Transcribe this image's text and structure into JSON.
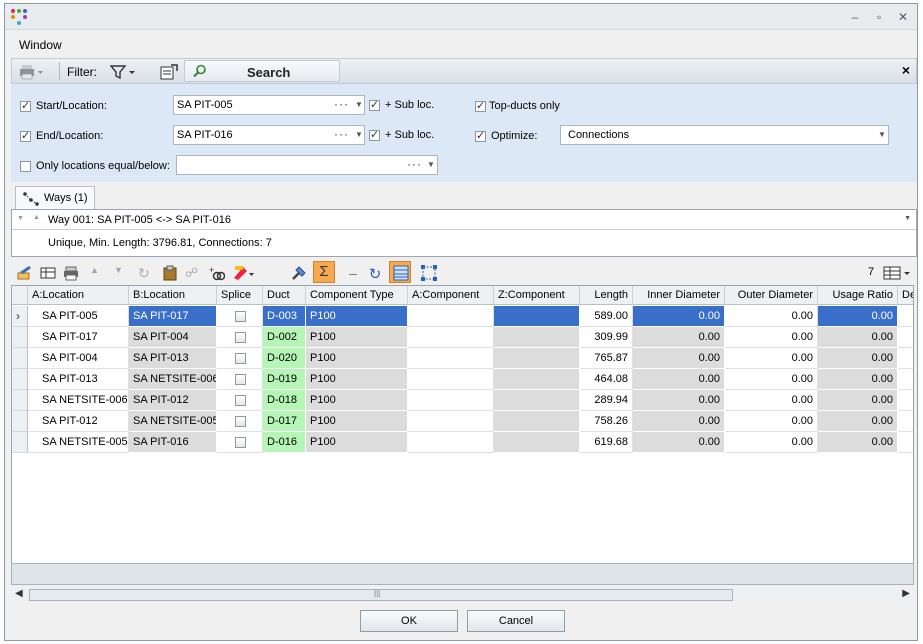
{
  "menu": {
    "window": "Window"
  },
  "toolbar": {
    "filter_label": "Filter:",
    "search_label": "Search",
    "close": "×"
  },
  "params": {
    "start_label": "Start/Location:",
    "start_value": "SA PIT-005",
    "end_label": "End/Location:",
    "end_value": "SA PIT-016",
    "only_label": "Only locations equal/below:",
    "only_value": "",
    "sub_loc_label": "+ Sub loc.",
    "top_ducts_label": "Top-ducts only",
    "optimize_label": "Optimize:",
    "optimize_value": "Connections",
    "dots": "···"
  },
  "tabs": {
    "ways": "Ways (1)"
  },
  "ways": {
    "row": "Way 001: SA PIT-005 <-> SA PIT-016",
    "summary": "Unique, Min. Length: 3796.81, Connections: 7"
  },
  "grid_toolbar": {
    "count": "7"
  },
  "grid": {
    "columns": [
      "A:Location",
      "B:Location",
      "Splice",
      "Duct",
      "Component Type",
      "A:Component",
      "Z:Component",
      "Length",
      "Inner Diameter",
      "Outer Diameter",
      "Usage Ratio",
      "De"
    ],
    "rows": [
      {
        "a": "SA PIT-005",
        "b": "SA PIT-017",
        "duct": "D-003",
        "type": "P100",
        "length": "589.00",
        "inner": "0.00",
        "outer": "0.00",
        "usage": "0.00"
      },
      {
        "a": "SA PIT-017",
        "b": "SA PIT-004",
        "duct": "D-002",
        "type": "P100",
        "length": "309.99",
        "inner": "0.00",
        "outer": "0.00",
        "usage": "0.00"
      },
      {
        "a": "SA PIT-004",
        "b": "SA PIT-013",
        "duct": "D-020",
        "type": "P100",
        "length": "765.87",
        "inner": "0.00",
        "outer": "0.00",
        "usage": "0.00"
      },
      {
        "a": "SA PIT-013",
        "b": "SA NETSITE-006",
        "duct": "D-019",
        "type": "P100",
        "length": "464.08",
        "inner": "0.00",
        "outer": "0.00",
        "usage": "0.00"
      },
      {
        "a": "SA NETSITE-006",
        "b": "SA PIT-012",
        "duct": "D-018",
        "type": "P100",
        "length": "289.94",
        "inner": "0.00",
        "outer": "0.00",
        "usage": "0.00"
      },
      {
        "a": "SA PIT-012",
        "b": "SA NETSITE-005",
        "duct": "D-017",
        "type": "P100",
        "length": "758.26",
        "inner": "0.00",
        "outer": "0.00",
        "usage": "0.00"
      },
      {
        "a": "SA NETSITE-005",
        "b": "SA PIT-016",
        "duct": "D-016",
        "type": "P100",
        "length": "619.68",
        "inner": "0.00",
        "outer": "0.00",
        "usage": "0.00"
      }
    ]
  },
  "buttons": {
    "ok": "OK",
    "cancel": "Cancel"
  },
  "colors": {
    "selection": "#3a6fc9",
    "duct_highlight": "#b5f5b5",
    "param_bg": "#dde8f7"
  }
}
